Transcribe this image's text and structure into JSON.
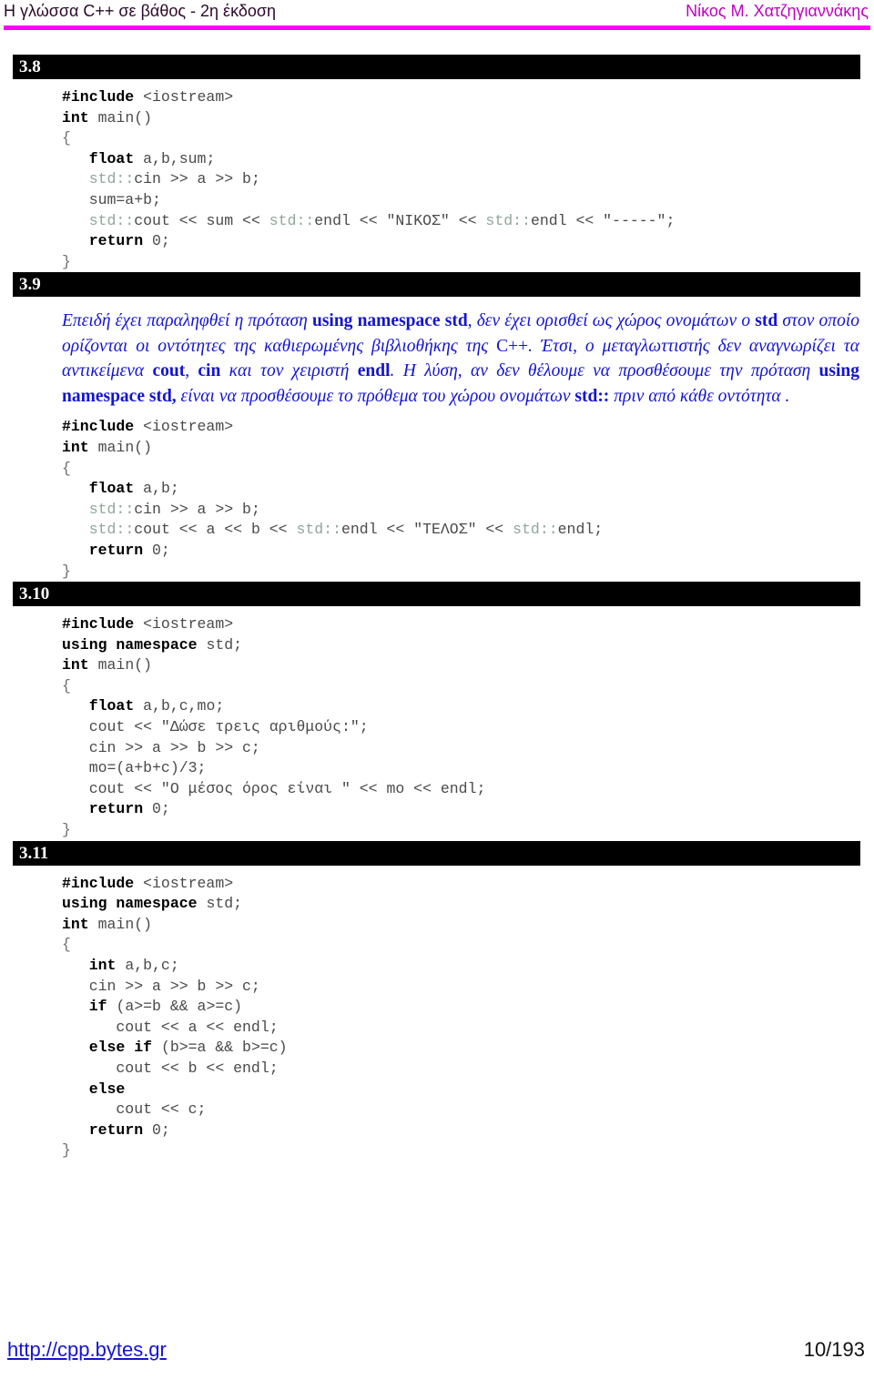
{
  "header": {
    "left_title": "Η γλώσσα C++ σε βάθος - 2η έκδοση",
    "right_author": "Νίκος Μ. Χατζηγιαννάκης",
    "rule_color": "#ff00ff"
  },
  "footer": {
    "url": "http://cpp.bytes.gr",
    "page_number": "10/193"
  },
  "colors": {
    "banner_bg": "#000000",
    "banner_text": "#ffffff",
    "prose_blue": "#1414d2",
    "code_gray": "#4a4a4a",
    "code_keyword": "#000000",
    "namespace_tint": "#8fa79b"
  },
  "sections": [
    {
      "number": "3.8",
      "code": [
        [
          {
            "t": "#include ",
            "s": "kw"
          },
          {
            "t": "<iostream>",
            "s": "plain"
          }
        ],
        [
          {
            "t": "int ",
            "s": "kw"
          },
          {
            "t": "main()",
            "s": "plain"
          }
        ],
        [
          {
            "t": "{",
            "s": "brace"
          }
        ],
        [
          {
            "t": "   ",
            "s": "plain"
          },
          {
            "t": "float ",
            "s": "kw"
          },
          {
            "t": "a,b,sum;",
            "s": "plain"
          }
        ],
        [
          {
            "t": "   ",
            "s": "plain"
          },
          {
            "t": "std::",
            "s": "ns"
          },
          {
            "t": "cin >> a >> b;",
            "s": "plain"
          }
        ],
        [
          {
            "t": "   sum=a+b;",
            "s": "plain"
          }
        ],
        [
          {
            "t": "   ",
            "s": "plain"
          },
          {
            "t": "std::",
            "s": "ns"
          },
          {
            "t": "cout << sum << ",
            "s": "plain"
          },
          {
            "t": "std::",
            "s": "ns"
          },
          {
            "t": "endl << \"ΝΙΚΟΣ\" << ",
            "s": "plain"
          },
          {
            "t": "std::",
            "s": "ns"
          },
          {
            "t": "endl << \"-----\";",
            "s": "plain"
          }
        ],
        [
          {
            "t": "   ",
            "s": "plain"
          },
          {
            "t": "return ",
            "s": "kw"
          },
          {
            "t": "0;",
            "s": "plain"
          }
        ],
        [
          {
            "t": "}",
            "s": "brace"
          }
        ]
      ]
    },
    {
      "number": "3.9",
      "prose_html": "Επειδή έχει παραληφθεί η πρόταση <b>using namespace std</b>, δεν έχει ορισθεί ως χώρος ονομάτων ο <b>std</b> στον οποίο ορίζονται οι οντότητες της καθιερωμένης βιβλιοθήκης της <span class=\"nonital\">C++</span>. Έτσι, ο μεταγλωττιστής δεν αναγνωρίζει τα αντικείμενα <b>cout</b>, <b>cin</b> και τον χειριστή <b>endl</b>. Η λύση, αν δεν θέλουμε να προσθέσουμε την πρόταση <b>using namespace std,</b> είναι να προσθέσουμε το πρόθεμα του χώρου ονομάτων <b>std::</b> πριν από κάθε οντότητα .",
      "prose_text": "Επειδή έχει παραληφθεί η πρόταση using namespace std, δεν έχει ορισθεί ως χώρος ονομάτων ο std στον οποίο ορίζονται οι οντότητες της καθιερωμένης βιβλιοθήκης της C++. Έτσι, ο μεταγλωττιστής δεν αναγνωρίζει τα αντικείμενα cout, cin και τον χειριστή endl. Η λύση, αν δεν θέλουμε να προσθέσουμε την πρόταση using namespace std, είναι να προσθέσουμε το πρόθεμα του χώρου ονομάτων std:: πριν από κάθε οντότητα .",
      "code": [
        [
          {
            "t": "#include ",
            "s": "kw"
          },
          {
            "t": "<iostream>",
            "s": "plain"
          }
        ],
        [
          {
            "t": "int ",
            "s": "kw"
          },
          {
            "t": "main()",
            "s": "plain"
          }
        ],
        [
          {
            "t": "{",
            "s": "brace"
          }
        ],
        [
          {
            "t": "   ",
            "s": "plain"
          },
          {
            "t": "float ",
            "s": "kw"
          },
          {
            "t": "a,b;",
            "s": "plain"
          }
        ],
        [
          {
            "t": "   ",
            "s": "plain"
          },
          {
            "t": "std::",
            "s": "ns"
          },
          {
            "t": "cin >> a >> b;",
            "s": "plain"
          }
        ],
        [
          {
            "t": "   ",
            "s": "plain"
          },
          {
            "t": "std::",
            "s": "ns"
          },
          {
            "t": "cout << a << b << ",
            "s": "plain"
          },
          {
            "t": "std::",
            "s": "ns"
          },
          {
            "t": "endl << \"ΤΕΛΟΣ\" << ",
            "s": "plain"
          },
          {
            "t": "std::",
            "s": "ns"
          },
          {
            "t": "endl;",
            "s": "plain"
          }
        ],
        [
          {
            "t": "   ",
            "s": "plain"
          },
          {
            "t": "return ",
            "s": "kw"
          },
          {
            "t": "0;",
            "s": "plain"
          }
        ],
        [
          {
            "t": "}",
            "s": "brace"
          }
        ]
      ]
    },
    {
      "number": "3.10",
      "code": [
        [
          {
            "t": "#include ",
            "s": "kw"
          },
          {
            "t": "<iostream>",
            "s": "plain"
          }
        ],
        [
          {
            "t": "using namespace ",
            "s": "kw"
          },
          {
            "t": "std;",
            "s": "plain"
          }
        ],
        [
          {
            "t": "int ",
            "s": "kw"
          },
          {
            "t": "main()",
            "s": "plain"
          }
        ],
        [
          {
            "t": "{",
            "s": "brace"
          }
        ],
        [
          {
            "t": "   ",
            "s": "plain"
          },
          {
            "t": "float ",
            "s": "kw"
          },
          {
            "t": "a,b,c,mo;",
            "s": "plain"
          }
        ],
        [
          {
            "t": "   cout << \"Δώσε τρεις αριθμούς:\";",
            "s": "plain"
          }
        ],
        [
          {
            "t": "   cin >> a >> b >> c;",
            "s": "plain"
          }
        ],
        [
          {
            "t": "   mo=(a+b+c)/3;",
            "s": "plain"
          }
        ],
        [
          {
            "t": "   cout << \"Ο μέσος όρος είναι \" << mo << endl;",
            "s": "plain"
          }
        ],
        [
          {
            "t": "   ",
            "s": "plain"
          },
          {
            "t": "return ",
            "s": "kw"
          },
          {
            "t": "0;",
            "s": "plain"
          }
        ],
        [
          {
            "t": "}",
            "s": "brace"
          }
        ]
      ]
    },
    {
      "number": "3.11",
      "code": [
        [
          {
            "t": "#include ",
            "s": "kw"
          },
          {
            "t": "<iostream>",
            "s": "plain"
          }
        ],
        [
          {
            "t": "using namespace ",
            "s": "kw"
          },
          {
            "t": "std;",
            "s": "plain"
          }
        ],
        [
          {
            "t": "int ",
            "s": "kw"
          },
          {
            "t": "main()",
            "s": "plain"
          }
        ],
        [
          {
            "t": "{",
            "s": "brace"
          }
        ],
        [
          {
            "t": "   ",
            "s": "plain"
          },
          {
            "t": "int ",
            "s": "kw"
          },
          {
            "t": "a,b,c;",
            "s": "plain"
          }
        ],
        [
          {
            "t": "   cin >> a >> b >> c;",
            "s": "plain"
          }
        ],
        [
          {
            "t": "   ",
            "s": "plain"
          },
          {
            "t": "if ",
            "s": "kw"
          },
          {
            "t": "(a>=b && a>=c)",
            "s": "plain"
          }
        ],
        [
          {
            "t": "      cout << a << endl;",
            "s": "plain"
          }
        ],
        [
          {
            "t": "   ",
            "s": "plain"
          },
          {
            "t": "else if ",
            "s": "kw"
          },
          {
            "t": "(b>=a && b>=c)",
            "s": "plain"
          }
        ],
        [
          {
            "t": "      cout << b << endl;",
            "s": "plain"
          }
        ],
        [
          {
            "t": "   ",
            "s": "plain"
          },
          {
            "t": "else",
            "s": "kw"
          }
        ],
        [
          {
            "t": "      cout << c;",
            "s": "plain"
          }
        ],
        [
          {
            "t": "   ",
            "s": "plain"
          },
          {
            "t": "return ",
            "s": "kw"
          },
          {
            "t": "0;",
            "s": "plain"
          }
        ],
        [
          {
            "t": "}",
            "s": "brace"
          }
        ]
      ]
    }
  ]
}
